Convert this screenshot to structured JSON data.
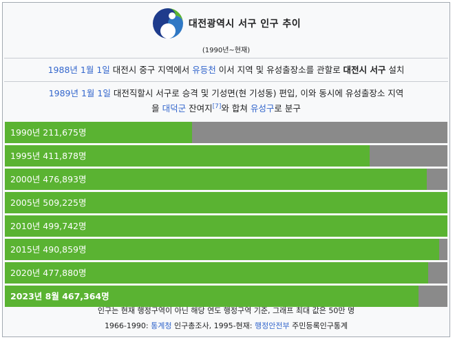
{
  "header": {
    "title": "대전광역시 서구 인구 추이",
    "subtitle": "(1990년~현재)"
  },
  "history": [
    {
      "date": "1988년 1월 1일",
      "text_a": " 대전시 중구 지역에서 ",
      "link": "유등천",
      "text_b": " 이서 지역 및 유성출장소를 관할로 ",
      "bold": "대전시 서구",
      "text_c": " 설치"
    },
    {
      "date": "1989년 1월 1일",
      "text_a": " 대전직할시 서구로 승격 및 기성면(현 기성동) 편입, 이와 동시에 유성출장소 지역",
      "line2_a": "을 ",
      "link1": "대덕군",
      "line2_b": " 잔여지",
      "ref": "[7]",
      "line2_c": "와 합쳐 ",
      "link2": "유성구",
      "line2_d": "로 분구"
    }
  ],
  "bars": [
    {
      "label": "1990년 211,675명",
      "value": 211675,
      "bold": false
    },
    {
      "label": "1995년 411,878명",
      "value": 411878,
      "bold": false
    },
    {
      "label": "2000년 476,893명",
      "value": 476893,
      "bold": false
    },
    {
      "label": "2005년 509,225명",
      "value": 509225,
      "bold": false
    },
    {
      "label": "2010년 499,742명",
      "value": 499742,
      "bold": false
    },
    {
      "label": "2015년 490,859명",
      "value": 490859,
      "bold": false
    },
    {
      "label": "2020년 477,880명",
      "value": 477880,
      "bold": false
    },
    {
      "label": "2023년 8월 467,364명",
      "value": 467364,
      "bold": true
    }
  ],
  "bar_max": 500000,
  "colors": {
    "fill": "#5ab332",
    "track": "#8a8a8a",
    "link": "#3366cc"
  },
  "footnote": {
    "line1": "인구는 현재 행정구역이 아닌 해당 연도 행정구역 기준, 그래프 최대 값은 50만 명",
    "line2_a": "1966-1990: ",
    "link1": "통계청",
    "line2_b": " 인구총조사, 1995-현재: ",
    "link2": "행정안전부",
    "line2_c": " 주민등록인구통계"
  }
}
